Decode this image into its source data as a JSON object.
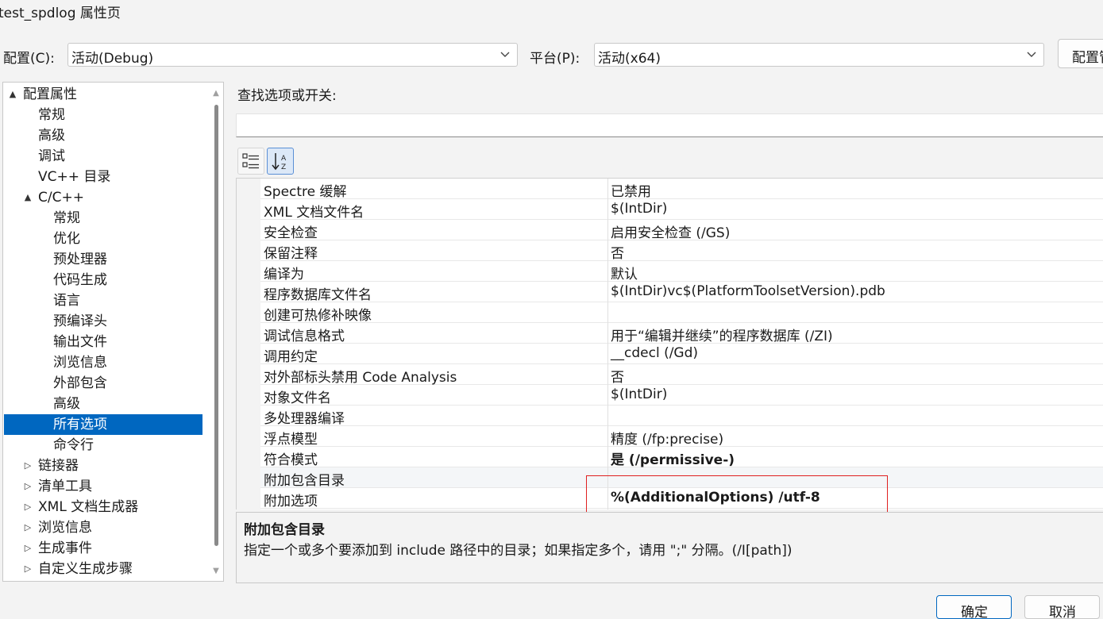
{
  "window": {
    "title": "test_spdlog 属性页"
  },
  "config_bar": {
    "config_label": "配置(C):",
    "config_value": "活动(Debug)",
    "platform_label": "平台(P):",
    "platform_value": "活动(x64)",
    "config_manager_label": "配置管理器(O)..."
  },
  "tree": {
    "items": [
      {
        "label": "配置属性",
        "expander": "▲"
      },
      {
        "label": "常规"
      },
      {
        "label": "高级"
      },
      {
        "label": "调试"
      },
      {
        "label": "VC++ 目录"
      },
      {
        "label": "C/C++",
        "expander": "▲"
      },
      {
        "label": "常规"
      },
      {
        "label": "优化"
      },
      {
        "label": "预处理器"
      },
      {
        "label": "代码生成"
      },
      {
        "label": "语言"
      },
      {
        "label": "预编译头"
      },
      {
        "label": "输出文件"
      },
      {
        "label": "浏览信息"
      },
      {
        "label": "外部包含"
      },
      {
        "label": "高级"
      },
      {
        "label": "所有选项",
        "selected": true
      },
      {
        "label": "命令行"
      },
      {
        "label": "链接器",
        "expander": "▷"
      },
      {
        "label": "清单工具",
        "expander": "▷"
      },
      {
        "label": "XML 文档生成器",
        "expander": "▷"
      },
      {
        "label": "浏览信息",
        "expander": "▷"
      },
      {
        "label": "生成事件",
        "expander": "▷"
      },
      {
        "label": "自定义生成步骤",
        "expander": "▷"
      }
    ]
  },
  "search": {
    "label": "查找选项或开关:",
    "value": ""
  },
  "toolbar": {
    "categorized_icon": "categorized-view-icon",
    "alphabetical_icon": "sort-alphabetical-icon"
  },
  "properties": [
    {
      "name": "Spectre 缓解",
      "value": "已禁用"
    },
    {
      "name": "XML 文档文件名",
      "value": "$(IntDir)"
    },
    {
      "name": "安全检查",
      "value": "启用安全检查 (/GS)"
    },
    {
      "name": "保留注释",
      "value": "否"
    },
    {
      "name": "编译为",
      "value": "默认"
    },
    {
      "name": "程序数据库文件名",
      "value": "$(IntDir)vc$(PlatformToolsetVersion).pdb"
    },
    {
      "name": "创建可热修补映像",
      "value": ""
    },
    {
      "name": "调试信息格式",
      "value": "用于“编辑并继续”的程序数据库 (/ZI)"
    },
    {
      "name": "调用约定",
      "value": "__cdecl (/Gd)"
    },
    {
      "name": "对外部标头禁用 Code Analysis",
      "value": "否"
    },
    {
      "name": "对象文件名",
      "value": "$(IntDir)"
    },
    {
      "name": "多处理器编译",
      "value": ""
    },
    {
      "name": "浮点模型",
      "value": "精度 (/fp:precise)"
    },
    {
      "name": "符合模式",
      "value": "是 (/permissive-)",
      "bold": true
    },
    {
      "name": "附加包含目录",
      "value": "",
      "highlighted": true
    },
    {
      "name": "附加选项",
      "value": "%(AdditionalOptions) /utf-8",
      "bold": true
    }
  ],
  "description": {
    "title": "附加包含目录",
    "text": "指定一个或多个要添加到 include 路径中的目录；如果指定多个，请用 \";\" 分隔。(/I[path])"
  },
  "footer": {
    "ok_label": "确定",
    "cancel_label": "取消"
  },
  "colors": {
    "selection": "#0067c0",
    "annotation_box": "#e02020",
    "panel_bg": "#f3f3f3"
  }
}
